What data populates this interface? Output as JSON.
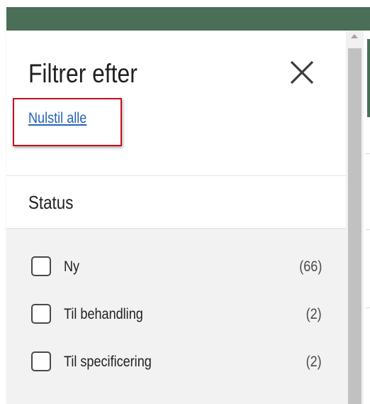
{
  "panel": {
    "title": "Filtrer efter",
    "reset_label": "Nulstil alle",
    "close_icon": "close-icon"
  },
  "section": {
    "title": "Status",
    "options": [
      {
        "label": "Ny",
        "count": "(66)",
        "checked": false
      },
      {
        "label": "Til behandling",
        "count": "(2)",
        "checked": false
      },
      {
        "label": "Til specificering",
        "count": "(2)",
        "checked": false
      }
    ]
  },
  "colors": {
    "top_bar": "#4a6e57",
    "link": "#2563b9",
    "highlight_border": "#c8101e",
    "options_bg": "#f2f2f2"
  }
}
